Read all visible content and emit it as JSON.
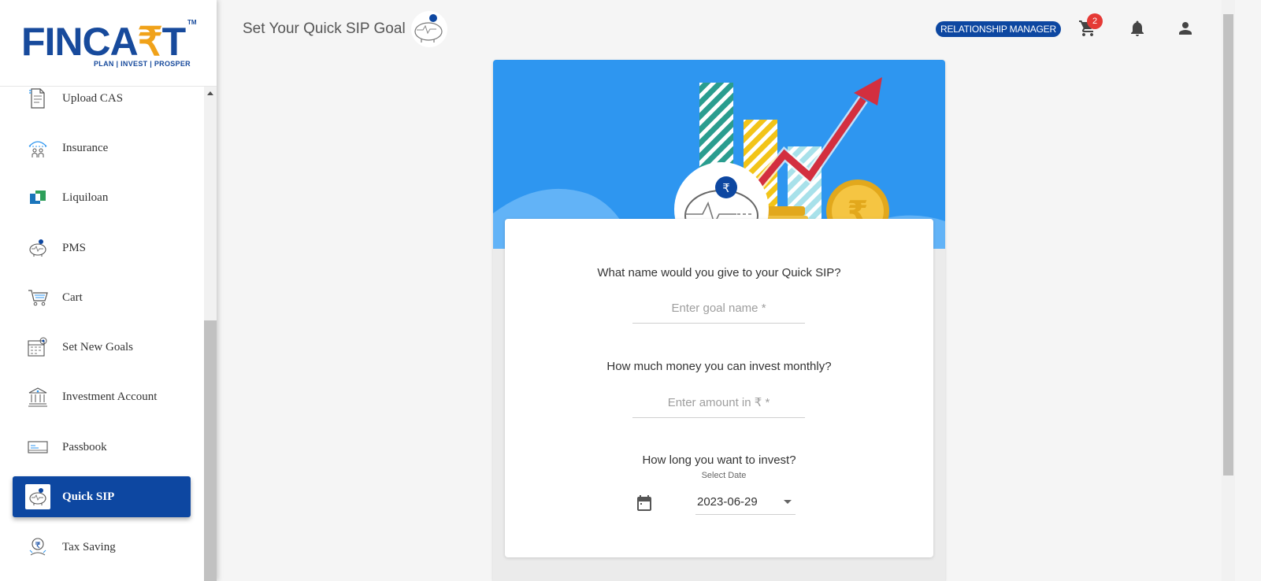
{
  "brand": {
    "name_part1": "FINCA",
    "name_rupee": "₹",
    "name_part2": "T",
    "tm": "TM",
    "tagline": "PLAN | INVEST | PROSPER"
  },
  "sidebar": {
    "items": [
      {
        "label": "Upload CAS",
        "icon": "document-upload-icon"
      },
      {
        "label": "Insurance",
        "icon": "umbrella-family-icon"
      },
      {
        "label": "Liquiloan",
        "icon": "liquiloan-logo-icon"
      },
      {
        "label": "PMS",
        "icon": "piggy-bank-icon"
      },
      {
        "label": "Cart",
        "icon": "cart-icon"
      },
      {
        "label": "Set New Goals",
        "icon": "goal-calendar-icon"
      },
      {
        "label": "Investment Account",
        "icon": "bank-building-icon"
      },
      {
        "label": "Passbook",
        "icon": "passbook-icon"
      },
      {
        "label": "Quick SIP",
        "icon": "piggy-bank-icon",
        "active": true
      },
      {
        "label": "Tax Saving",
        "icon": "tax-saving-icon"
      }
    ]
  },
  "header": {
    "title": "Set Your Quick SIP Goal",
    "rm_label": "RELATIONSHIP  MANAGER",
    "cart_count": "2"
  },
  "form": {
    "goal_question": "What name would you give to your Quick SIP?",
    "goal_placeholder": "Enter goal name *",
    "amount_question": "How much money you can invest monthly?",
    "amount_placeholder": "Enter amount in ₹ *",
    "duration_question": "How long you want to invest?",
    "date_caption": "Select Date",
    "date_value": "2023-06-29"
  },
  "colors": {
    "brand_blue": "#0d47a1",
    "hero_blue": "#2e96f0",
    "badge_red": "#e53935",
    "accent_gold": "#f0a21a"
  }
}
